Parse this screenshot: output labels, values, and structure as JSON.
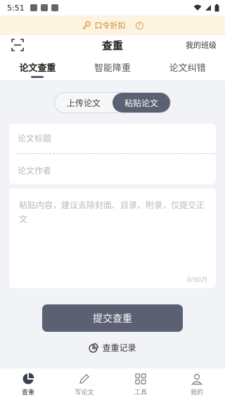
{
  "status_bar": {
    "time": "5:51"
  },
  "promo": {
    "label": "口令折扣",
    "help_glyph": "?"
  },
  "header": {
    "title": "查重",
    "my_class": "我的班级"
  },
  "tabs": [
    {
      "label": "论文查重",
      "active": true
    },
    {
      "label": "智能降重",
      "active": false
    },
    {
      "label": "论文纠错",
      "active": false
    }
  ],
  "segment": {
    "upload": "上传论文",
    "paste": "粘贴论文",
    "selected": "paste"
  },
  "form": {
    "title_placeholder": "论文标题",
    "author_placeholder": "论文作者",
    "content_placeholder": "粘贴内容，建议去除封面、目录、附录，仅提交正文",
    "char_count": "0/30万"
  },
  "submit_label": "提交查重",
  "record_label": "查重记录",
  "bottom_nav": [
    {
      "label": "查重",
      "icon": "pie-chart-icon",
      "active": true
    },
    {
      "label": "写论文",
      "icon": "pen-icon",
      "active": false
    },
    {
      "label": "工具",
      "icon": "grid-icon",
      "active": false
    },
    {
      "label": "我的",
      "icon": "user-icon",
      "active": false
    }
  ],
  "colors": {
    "accent": "#5b6073",
    "promo_bg": "#fdf3e1",
    "promo_text": "#c98a2e"
  }
}
